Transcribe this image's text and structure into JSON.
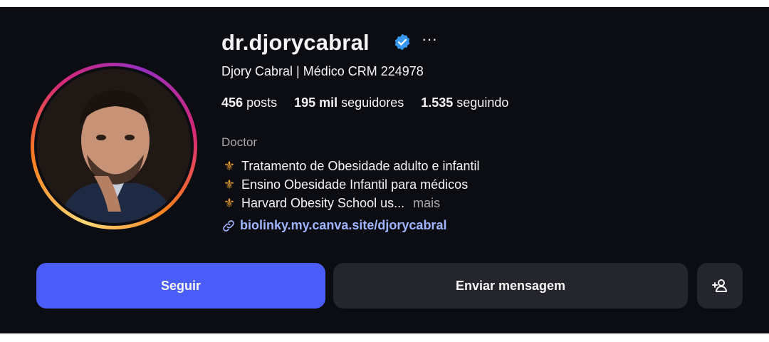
{
  "profile": {
    "username": "dr.djorycabral",
    "more_glyph": "···",
    "full_name": "Djory Cabral | Médico CRM 224978",
    "stats": {
      "posts_count": "456",
      "posts_label": "posts",
      "followers_count": "195 mil",
      "followers_label": "seguidores",
      "following_count": "1.535",
      "following_label": "seguindo"
    },
    "category": "Doctor",
    "bio": [
      {
        "emoji": "⚜",
        "text": "Tratamento de Obesidade adulto e infantil"
      },
      {
        "emoji": "⚜",
        "text": "Ensino Obesidade Infantil para médicos"
      },
      {
        "emoji": "⚜",
        "text": "Harvard Obesity School us..."
      }
    ],
    "bio_more": "mais",
    "link": "biolinky.my.canva.site/djorycabral"
  },
  "actions": {
    "follow_label": "Seguir",
    "message_label": "Enviar mensagem"
  },
  "icons": {
    "verified": "verified-badge-icon",
    "link": "link-icon",
    "add_user": "add-user-icon"
  },
  "colors": {
    "background": "#0c0d13",
    "follow_button": "#4a5df9",
    "secondary_button": "#25262d",
    "link": "#a0b4ff",
    "verified": "#3897f0",
    "muted_text": "#a8a8a8"
  }
}
